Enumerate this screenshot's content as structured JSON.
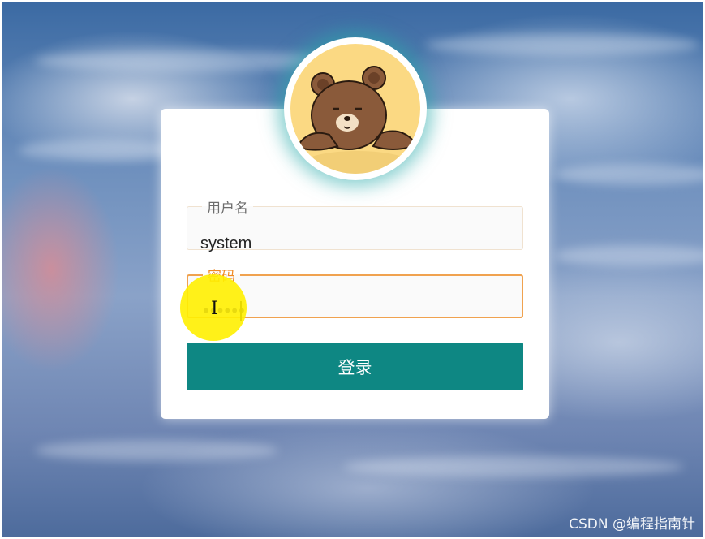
{
  "login_form": {
    "username": {
      "label": "用户名",
      "value": "system"
    },
    "password": {
      "label": "密码",
      "masked_value": "••••••"
    },
    "submit_label": "登录"
  },
  "avatar": {
    "icon": "brown-bear-avatar-icon"
  },
  "cursor": {
    "icon": "i-beam-cursor-icon",
    "glyph": "I"
  },
  "watermark": "CSDN @编程指南针",
  "colors": {
    "primary_button": "#0e8783",
    "focus_border": "#f0a24f",
    "avatar_bg": "#fbd983"
  }
}
